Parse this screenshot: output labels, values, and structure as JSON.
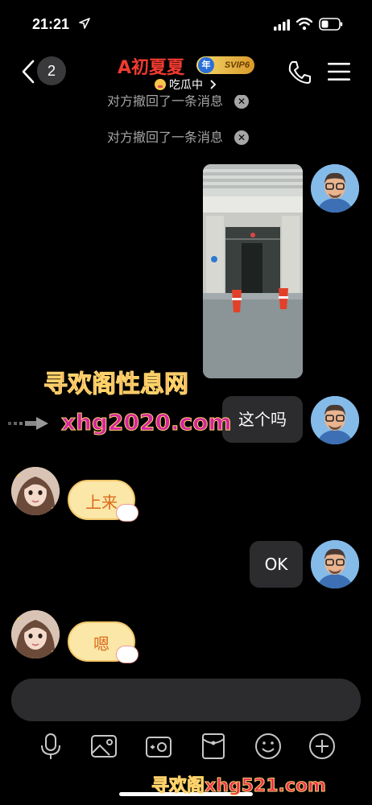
{
  "status_bar": {
    "time": "21:21"
  },
  "header": {
    "back_count": "2",
    "contact_name": "A初夏夏",
    "badge_label": "SVIP6",
    "badge_prefix": "年",
    "status_text": "吃瓜中"
  },
  "messages": {
    "recall_1": "对方撤回了一条消息",
    "recall_2": "对方撤回了一条消息",
    "text_1": "这个吗",
    "sticker_1": "上来",
    "text_2": "OK",
    "sticker_2": "嗯"
  },
  "watermark": {
    "title": "寻欢阁性息网",
    "url": "xhg2020.com",
    "bottom": "寻欢阁xhg521.com"
  },
  "toolbar_icons": [
    "microphone-icon",
    "image-icon",
    "camera-icon",
    "red-packet-icon",
    "emoji-icon",
    "plus-icon"
  ],
  "colors": {
    "name": "#f23a30",
    "bubble": "#2c2c2e",
    "background": "#000000",
    "recall_text": "#a5a5a5"
  }
}
